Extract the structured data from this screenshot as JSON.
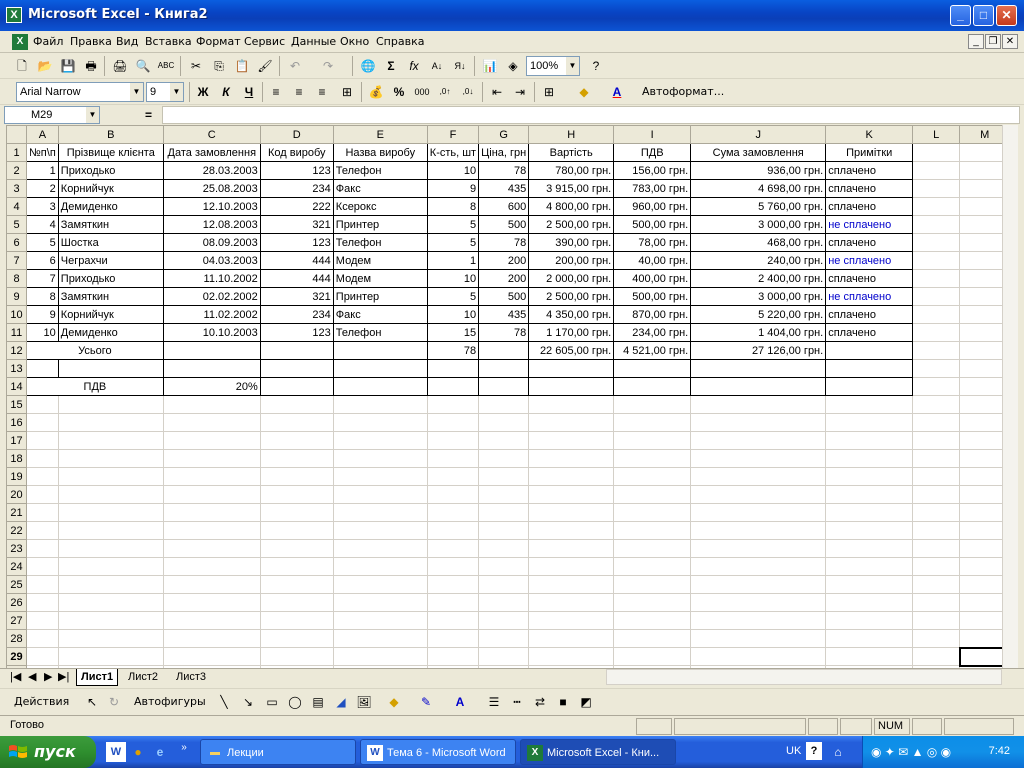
{
  "window": {
    "title": "Microsoft Excel - Книга2"
  },
  "menu": [
    "Файл",
    "Правка",
    "Вид",
    "Вставка",
    "Формат",
    "Сервис",
    "Данные",
    "Окно",
    "Справка"
  ],
  "toolbar": {
    "zoom": "100%"
  },
  "format_toolbar": {
    "font": "Arial Narrow",
    "size": "9",
    "bold": "Ж",
    "italic": "К",
    "underline": "Ч",
    "autoformat": "Автоформат..."
  },
  "formula_bar": {
    "name_box": "M29",
    "fx": "=",
    "content": ""
  },
  "columns": [
    "A",
    "B",
    "C",
    "D",
    "E",
    "F",
    "G",
    "H",
    "I",
    "J",
    "K",
    "L",
    "M"
  ],
  "rows": [
    [
      "№п\\п",
      "Прізвище клієнта",
      "Дата замовлення",
      "Код виробу",
      "Назва виробу",
      "К-сть, шт",
      "Ціна, грн",
      "Вартість",
      "ПДВ",
      "Сума замовлення",
      "Примітки",
      "",
      ""
    ],
    [
      "1",
      "Приходько",
      "28.03.2003",
      "123",
      "Телефон",
      "10",
      "78",
      "780,00 грн.",
      "156,00 грн.",
      "936,00 грн.",
      "сплачено",
      "",
      ""
    ],
    [
      "2",
      "Корнийчук",
      "25.08.2003",
      "234",
      "Факс",
      "9",
      "435",
      "3 915,00 грн.",
      "783,00 грн.",
      "4 698,00 грн.",
      "сплачено",
      "",
      ""
    ],
    [
      "3",
      "Демиденко",
      "12.10.2003",
      "222",
      "Ксерокс",
      "8",
      "600",
      "4 800,00 грн.",
      "960,00 грн.",
      "5 760,00 грн.",
      "сплачено",
      "",
      ""
    ],
    [
      "4",
      "Замяткин",
      "12.08.2003",
      "321",
      "Принтер",
      "5",
      "500",
      "2 500,00 грн.",
      "500,00 грн.",
      "3 000,00 грн.",
      "не сплачено",
      "",
      ""
    ],
    [
      "5",
      "Шостка",
      "08.09.2003",
      "123",
      "Телефон",
      "5",
      "78",
      "390,00 грн.",
      "78,00 грн.",
      "468,00 грн.",
      "сплачено",
      "",
      ""
    ],
    [
      "6",
      "Чеграхчи",
      "04.03.2003",
      "444",
      "Модем",
      "1",
      "200",
      "200,00 грн.",
      "40,00 грн.",
      "240,00 грн.",
      "не сплачено",
      "",
      ""
    ],
    [
      "7",
      "Приходько",
      "11.10.2002",
      "444",
      "Модем",
      "10",
      "200",
      "2 000,00 грн.",
      "400,00 грн.",
      "2 400,00 грн.",
      "сплачено",
      "",
      ""
    ],
    [
      "8",
      "Замяткин",
      "02.02.2002",
      "321",
      "Принтер",
      "5",
      "500",
      "2 500,00 грн.",
      "500,00 грн.",
      "3 000,00 грн.",
      "не сплачено",
      "",
      ""
    ],
    [
      "9",
      "Корнийчук",
      "11.02.2002",
      "234",
      "Факс",
      "10",
      "435",
      "4 350,00 грн.",
      "870,00 грн.",
      "5 220,00 грн.",
      "сплачено",
      "",
      ""
    ],
    [
      "10",
      "Демиденко",
      "10.10.2003",
      "123",
      "Телефон",
      "15",
      "78",
      "1 170,00 грн.",
      "234,00 грн.",
      "1 404,00 грн.",
      "сплачено",
      "",
      ""
    ],
    [
      "Усього",
      "",
      "",
      "",
      "",
      "78",
      "",
      "22 605,00 грн.",
      "4 521,00 грн.",
      "27 126,00 грн.",
      "",
      "",
      ""
    ],
    [
      "",
      "",
      "",
      "",
      "",
      "",
      "",
      "",
      "",
      "",
      "",
      "",
      ""
    ],
    [
      "ПДВ",
      "",
      "20%",
      "",
      "",
      "",
      "",
      "",
      "",
      "",
      "",
      "",
      ""
    ]
  ],
  "sheet_tabs": [
    "Лист1",
    "Лист2",
    "Лист3"
  ],
  "draw_toolbar": {
    "actions": "Действия",
    "autoshapes": "Автофигуры"
  },
  "status": {
    "ready": "Готово",
    "num": "NUM"
  },
  "taskbar": {
    "start": "пуск",
    "tasks": [
      "Лекции",
      "Тема 6 - Microsoft Word",
      "Microsoft Excel - Кни..."
    ],
    "lang": "UK",
    "clock": "7:42"
  }
}
